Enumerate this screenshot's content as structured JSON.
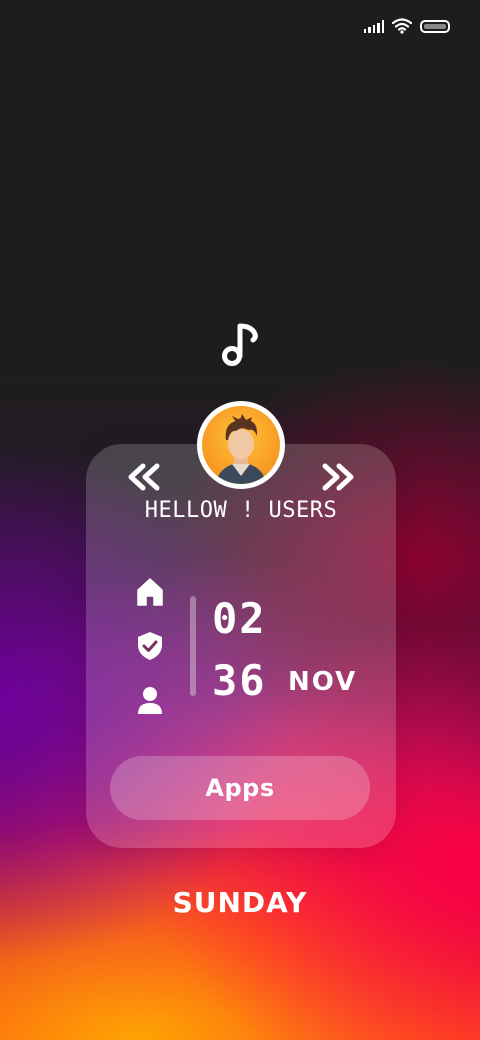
{
  "status_bar": {
    "icons": [
      "signal-icon",
      "wifi-icon",
      "battery-icon"
    ]
  },
  "widget": {
    "music_icon": "music-note-icon",
    "avatar": "user-avatar",
    "nav": {
      "prev_icon": "double-chevron-left-icon",
      "next_icon": "double-chevron-right-icon"
    },
    "greeting": "HELLOW ! USERS",
    "side_icons": [
      "home-icon",
      "shield-check-icon",
      "user-icon"
    ],
    "time": {
      "hour": "02",
      "minute": "36"
    },
    "month": "NOV",
    "apps_label": "Apps"
  },
  "day": "SUNDAY",
  "colors": {
    "text": "#ffffff",
    "top_background": "#1d1d1d",
    "accent_red": "#ff1e28",
    "accent_purple": "#6e00a0",
    "accent_orange": "#ffaa00"
  }
}
